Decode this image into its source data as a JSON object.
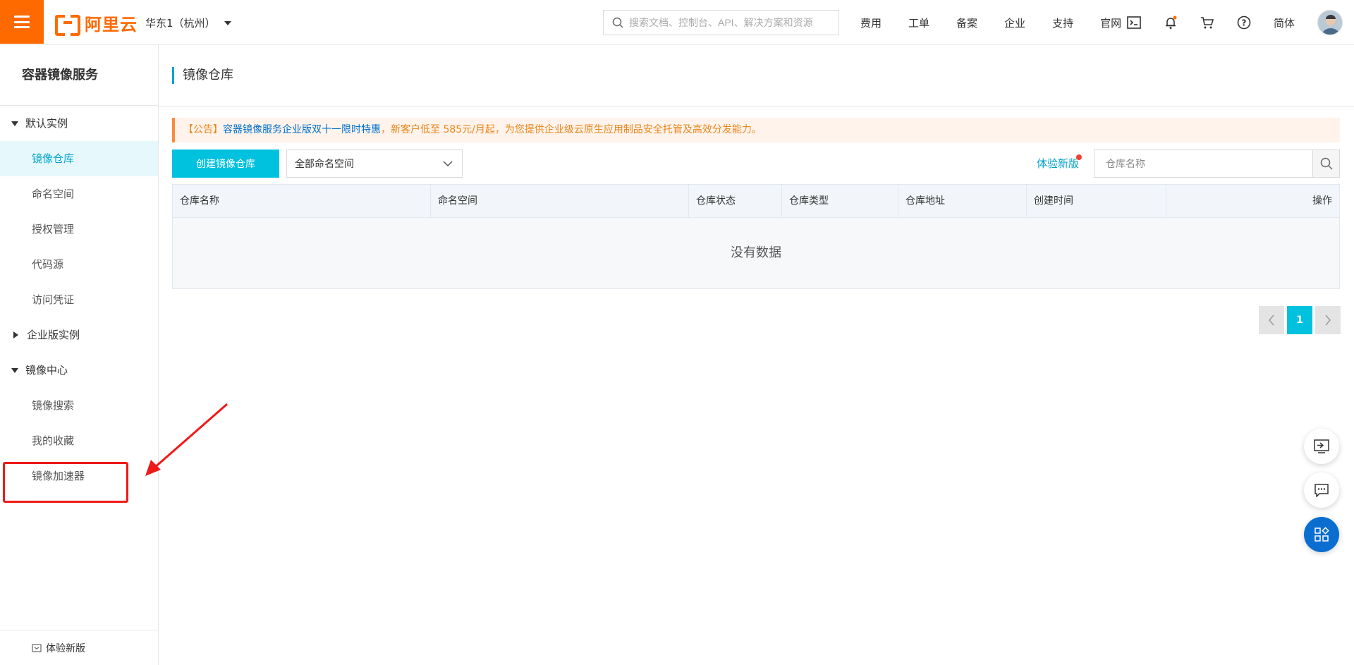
{
  "topbar": {
    "logo_text": "阿里云",
    "region": "华东1（杭州）",
    "search_placeholder": "搜索文档、控制台、API、解决方案和资源",
    "nav": [
      "费用",
      "工单",
      "备案",
      "企业",
      "支持",
      "官网"
    ],
    "language": "简体"
  },
  "sidebar": {
    "title": "容器镜像服务",
    "groups": [
      {
        "label": "默认实例",
        "expanded": true,
        "items": [
          "镜像仓库",
          "命名空间",
          "授权管理",
          "代码源",
          "访问凭证"
        ]
      },
      {
        "label": "企业版实例",
        "expanded": false,
        "items": []
      },
      {
        "label": "镜像中心",
        "expanded": true,
        "items": [
          "镜像搜索",
          "我的收藏",
          "镜像加速器"
        ]
      }
    ],
    "active_item": "镜像仓库",
    "footer": "体验新版"
  },
  "main": {
    "page_title": "镜像仓库",
    "notice": {
      "prefix": "【公告】",
      "link1": "容器镜像服务企业版",
      "link2": "双十一限时特惠",
      "text": "，新客户低至 585元/月起，为您提供企业级云原生应用制品安全托管及高效分发能力。"
    },
    "create_button": "创建镜像仓库",
    "namespace_select": "全部命名空间",
    "try_new": "体验新版",
    "name_search_placeholder": "仓库名称",
    "table": {
      "columns": [
        "仓库名称",
        "命名空间",
        "仓库状态",
        "仓库类型",
        "仓库地址",
        "创建时间",
        "操作"
      ],
      "empty_text": "没有数据"
    },
    "pagination": {
      "current_page": "1"
    }
  },
  "colors": {
    "brand": "#ff6a00",
    "primary": "#00c1de",
    "link": "#00a2ca",
    "annotation": "#f01919"
  }
}
